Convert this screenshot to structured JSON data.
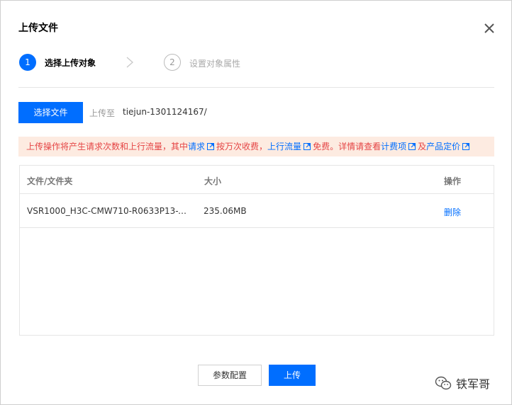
{
  "dialog": {
    "title": "上传文件",
    "close_icon": "close-icon"
  },
  "steps": [
    {
      "number": "1",
      "label": "选择上传对象",
      "state": "active"
    },
    {
      "number": "2",
      "label": "设置对象属性",
      "state": "inactive"
    }
  ],
  "toolbar": {
    "select_file_label": "选择文件",
    "upload_to_label": "上传至",
    "upload_path": "tiejun-1301124167/"
  },
  "notice": {
    "part1": "上传操作将产生请求次数和上行流量，其中",
    "link_request": "请求",
    "part2": "按万次收费，",
    "link_upstream": "上行流量",
    "part3": "免费。详情请查看",
    "link_billing_items": "计费项",
    "part4": "及",
    "link_pricing": "产品定价"
  },
  "table": {
    "headers": {
      "name": "文件/文件夹",
      "size": "大小",
      "action": "操作"
    },
    "rows": [
      {
        "name": "VSR1000_H3C-CMW710-R0633P13-X64....",
        "size": "235.06MB",
        "action": "删除"
      }
    ]
  },
  "footer": {
    "params_label": "参数配置",
    "upload_label": "上传"
  },
  "watermark": {
    "text": "铁军哥"
  },
  "colors": {
    "primary": "#006eff",
    "notice_bg": "#fdebe1",
    "notice_text": "#e54545"
  }
}
